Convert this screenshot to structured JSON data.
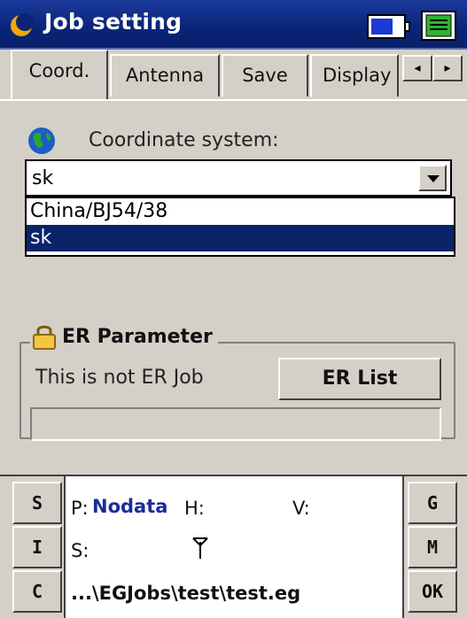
{
  "title_bar": {
    "title": "Job setting",
    "app_icon": "moon-icon",
    "battery_icon": "battery-icon",
    "notes_icon": "notes-icon"
  },
  "tabs": [
    {
      "label": "Coord.",
      "active": true
    },
    {
      "label": "Antenna",
      "active": false
    },
    {
      "label": "Save",
      "active": false
    },
    {
      "label": "Display",
      "active": false
    }
  ],
  "tab_scroll": {
    "left": "◂",
    "right": "▸"
  },
  "coord": {
    "label": "Coordinate system:",
    "selected": "sk",
    "options": [
      "China/BJ54/38",
      "sk"
    ],
    "selected_index": 1
  },
  "er": {
    "group_title": "ER Parameter",
    "status": "This is not ER Job",
    "button": "ER List",
    "field_value": ""
  },
  "status_panel": {
    "left_buttons": [
      "S",
      "I",
      "C"
    ],
    "right_buttons": [
      "G",
      "M",
      "OK"
    ],
    "p_label": "P:",
    "p_value": "Nodata",
    "h_label": "H:",
    "v_label": "V:",
    "s_label": "S:",
    "path": "...\\EGJobs\\test\\test.eg"
  },
  "colors": {
    "title_bar": "#0a2478",
    "selection": "#0a246a",
    "status_blue": "#1b2d9c"
  }
}
